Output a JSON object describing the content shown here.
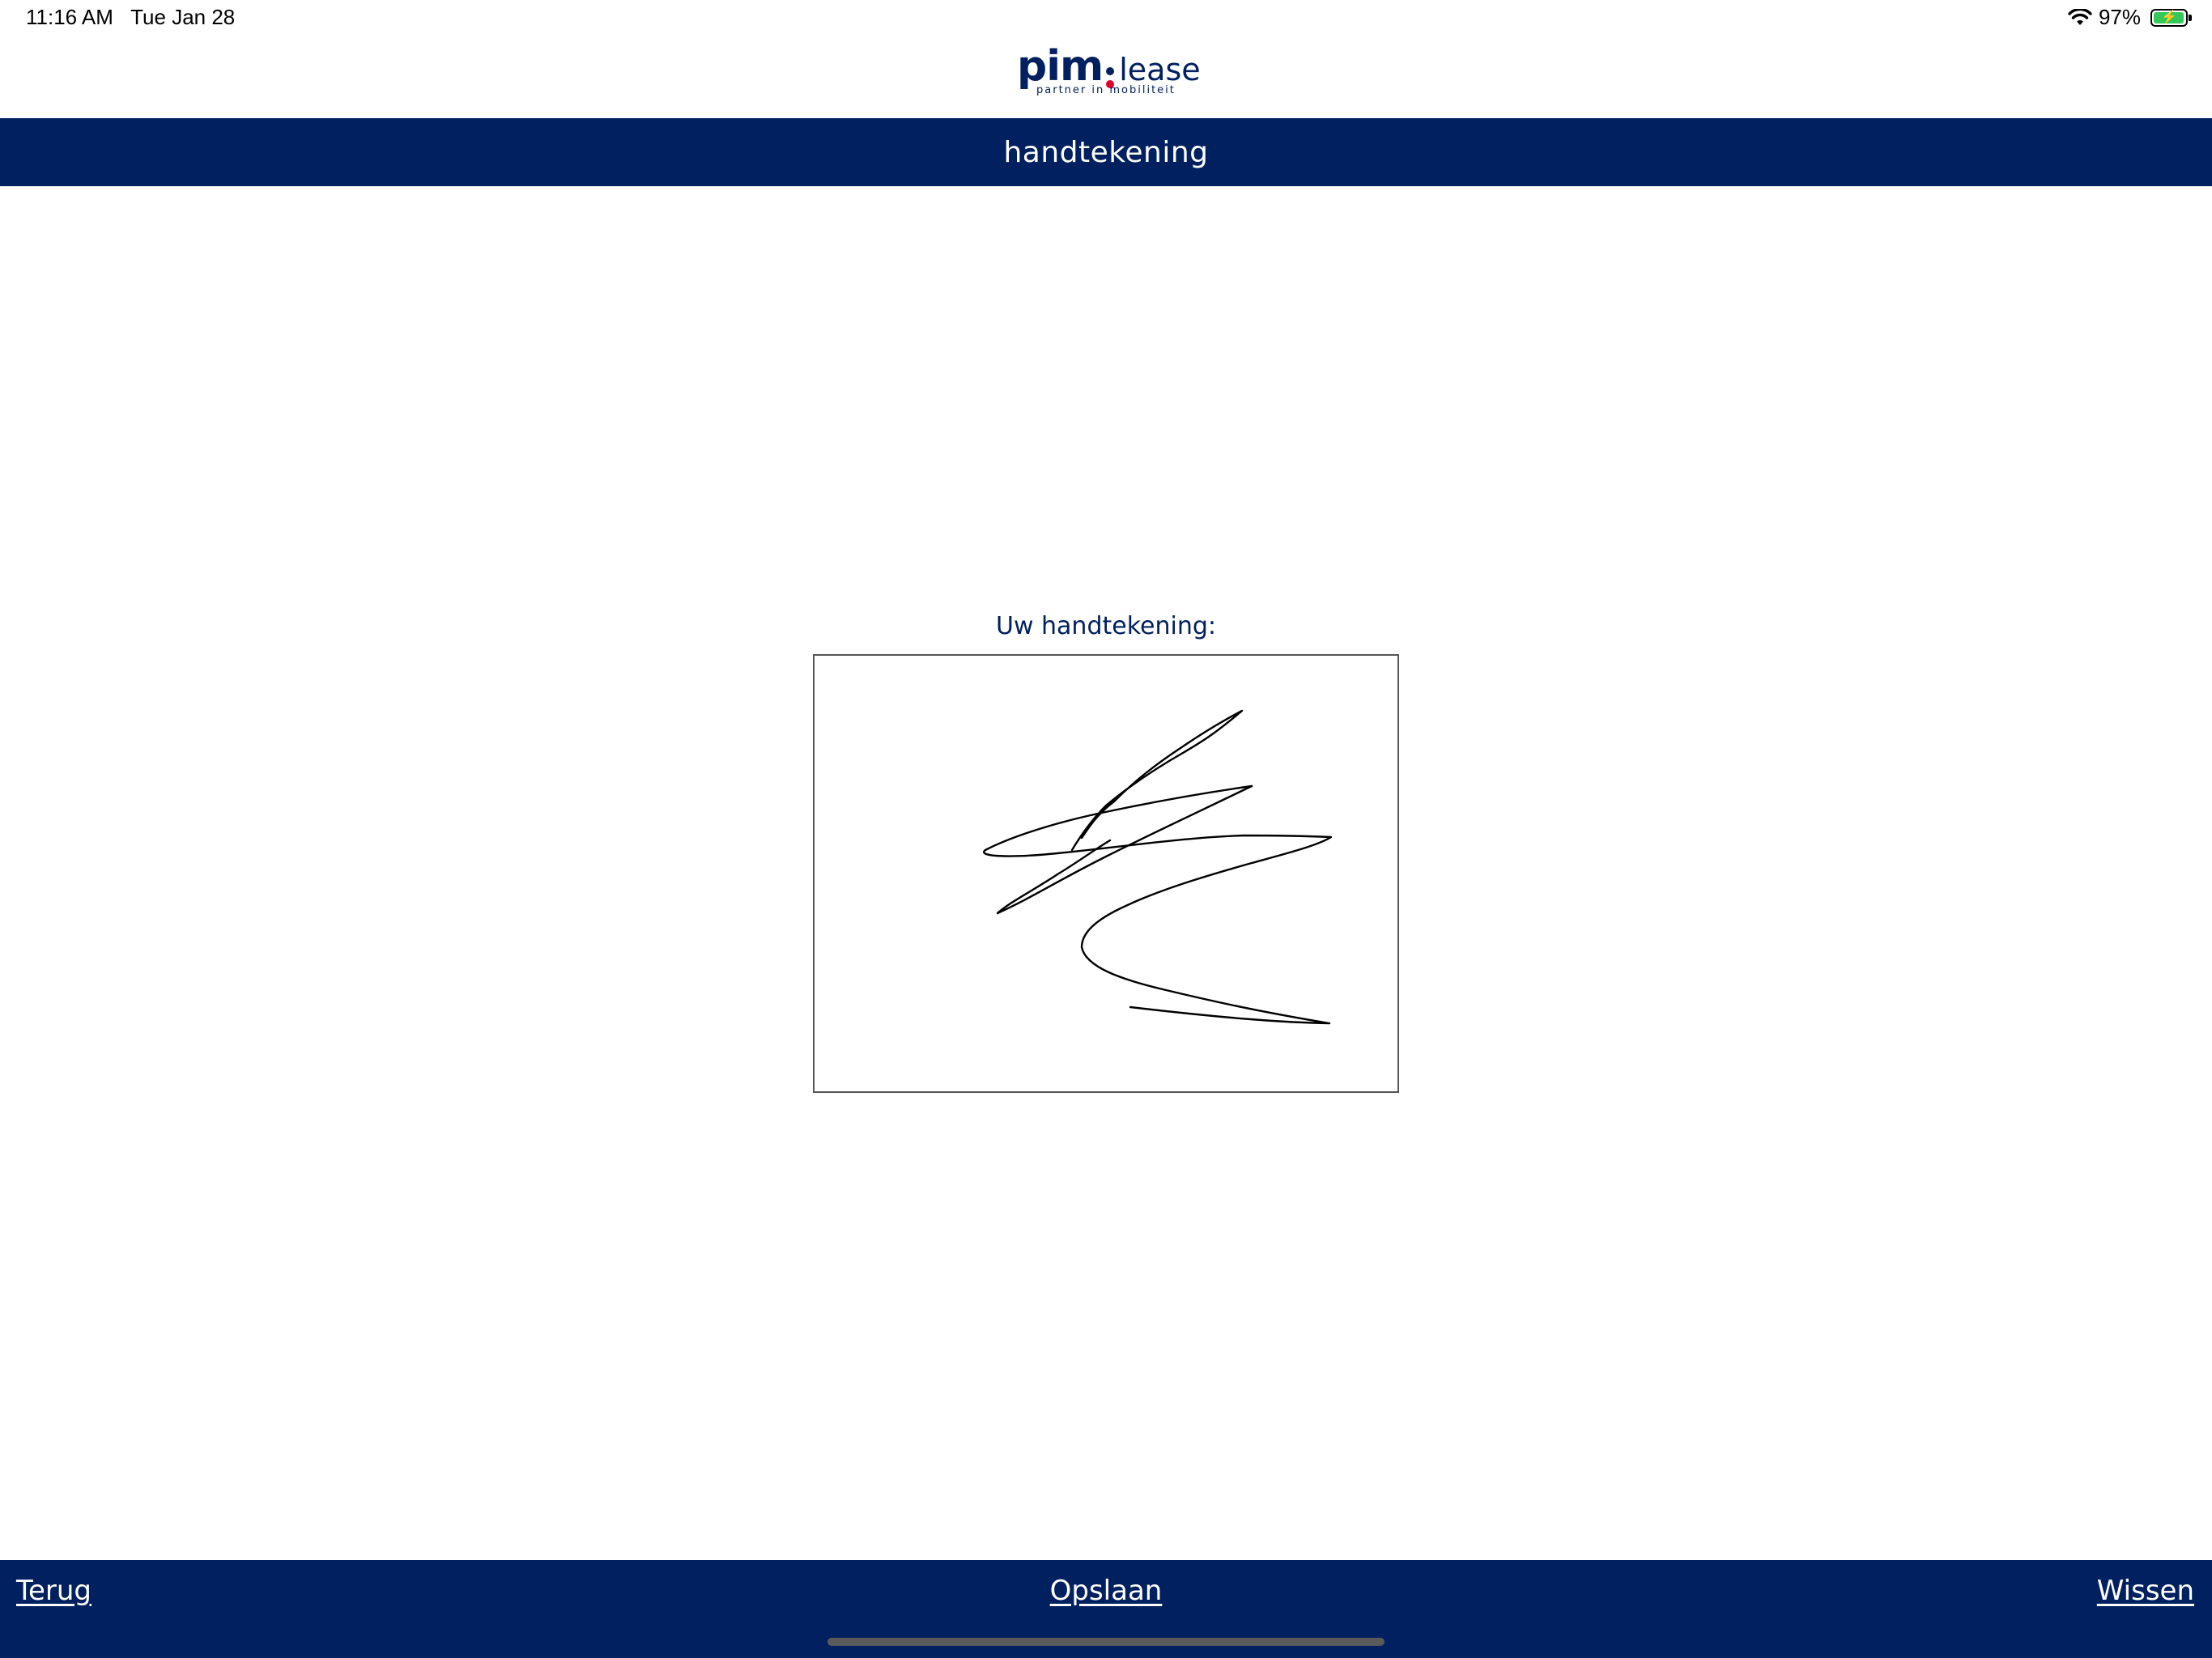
{
  "status_bar": {
    "time": "11:16 AM",
    "date": "Tue Jan 28",
    "battery_percent": "97%",
    "battery_level": 0.97,
    "icons": [
      "wifi-icon",
      "battery-charging-icon"
    ]
  },
  "logo": {
    "brand": "pim",
    "product": "lease",
    "tagline": "partner in mobiliteit"
  },
  "header": {
    "title": "handtekening"
  },
  "signature": {
    "label": "Uw handtekening:"
  },
  "footer": {
    "back_label": "Terug",
    "save_label": "Opslaan",
    "clear_label": "Wissen"
  },
  "colors": {
    "brand_navy": "#002060",
    "brand_red": "#e4002b",
    "battery_green": "#34c759"
  }
}
